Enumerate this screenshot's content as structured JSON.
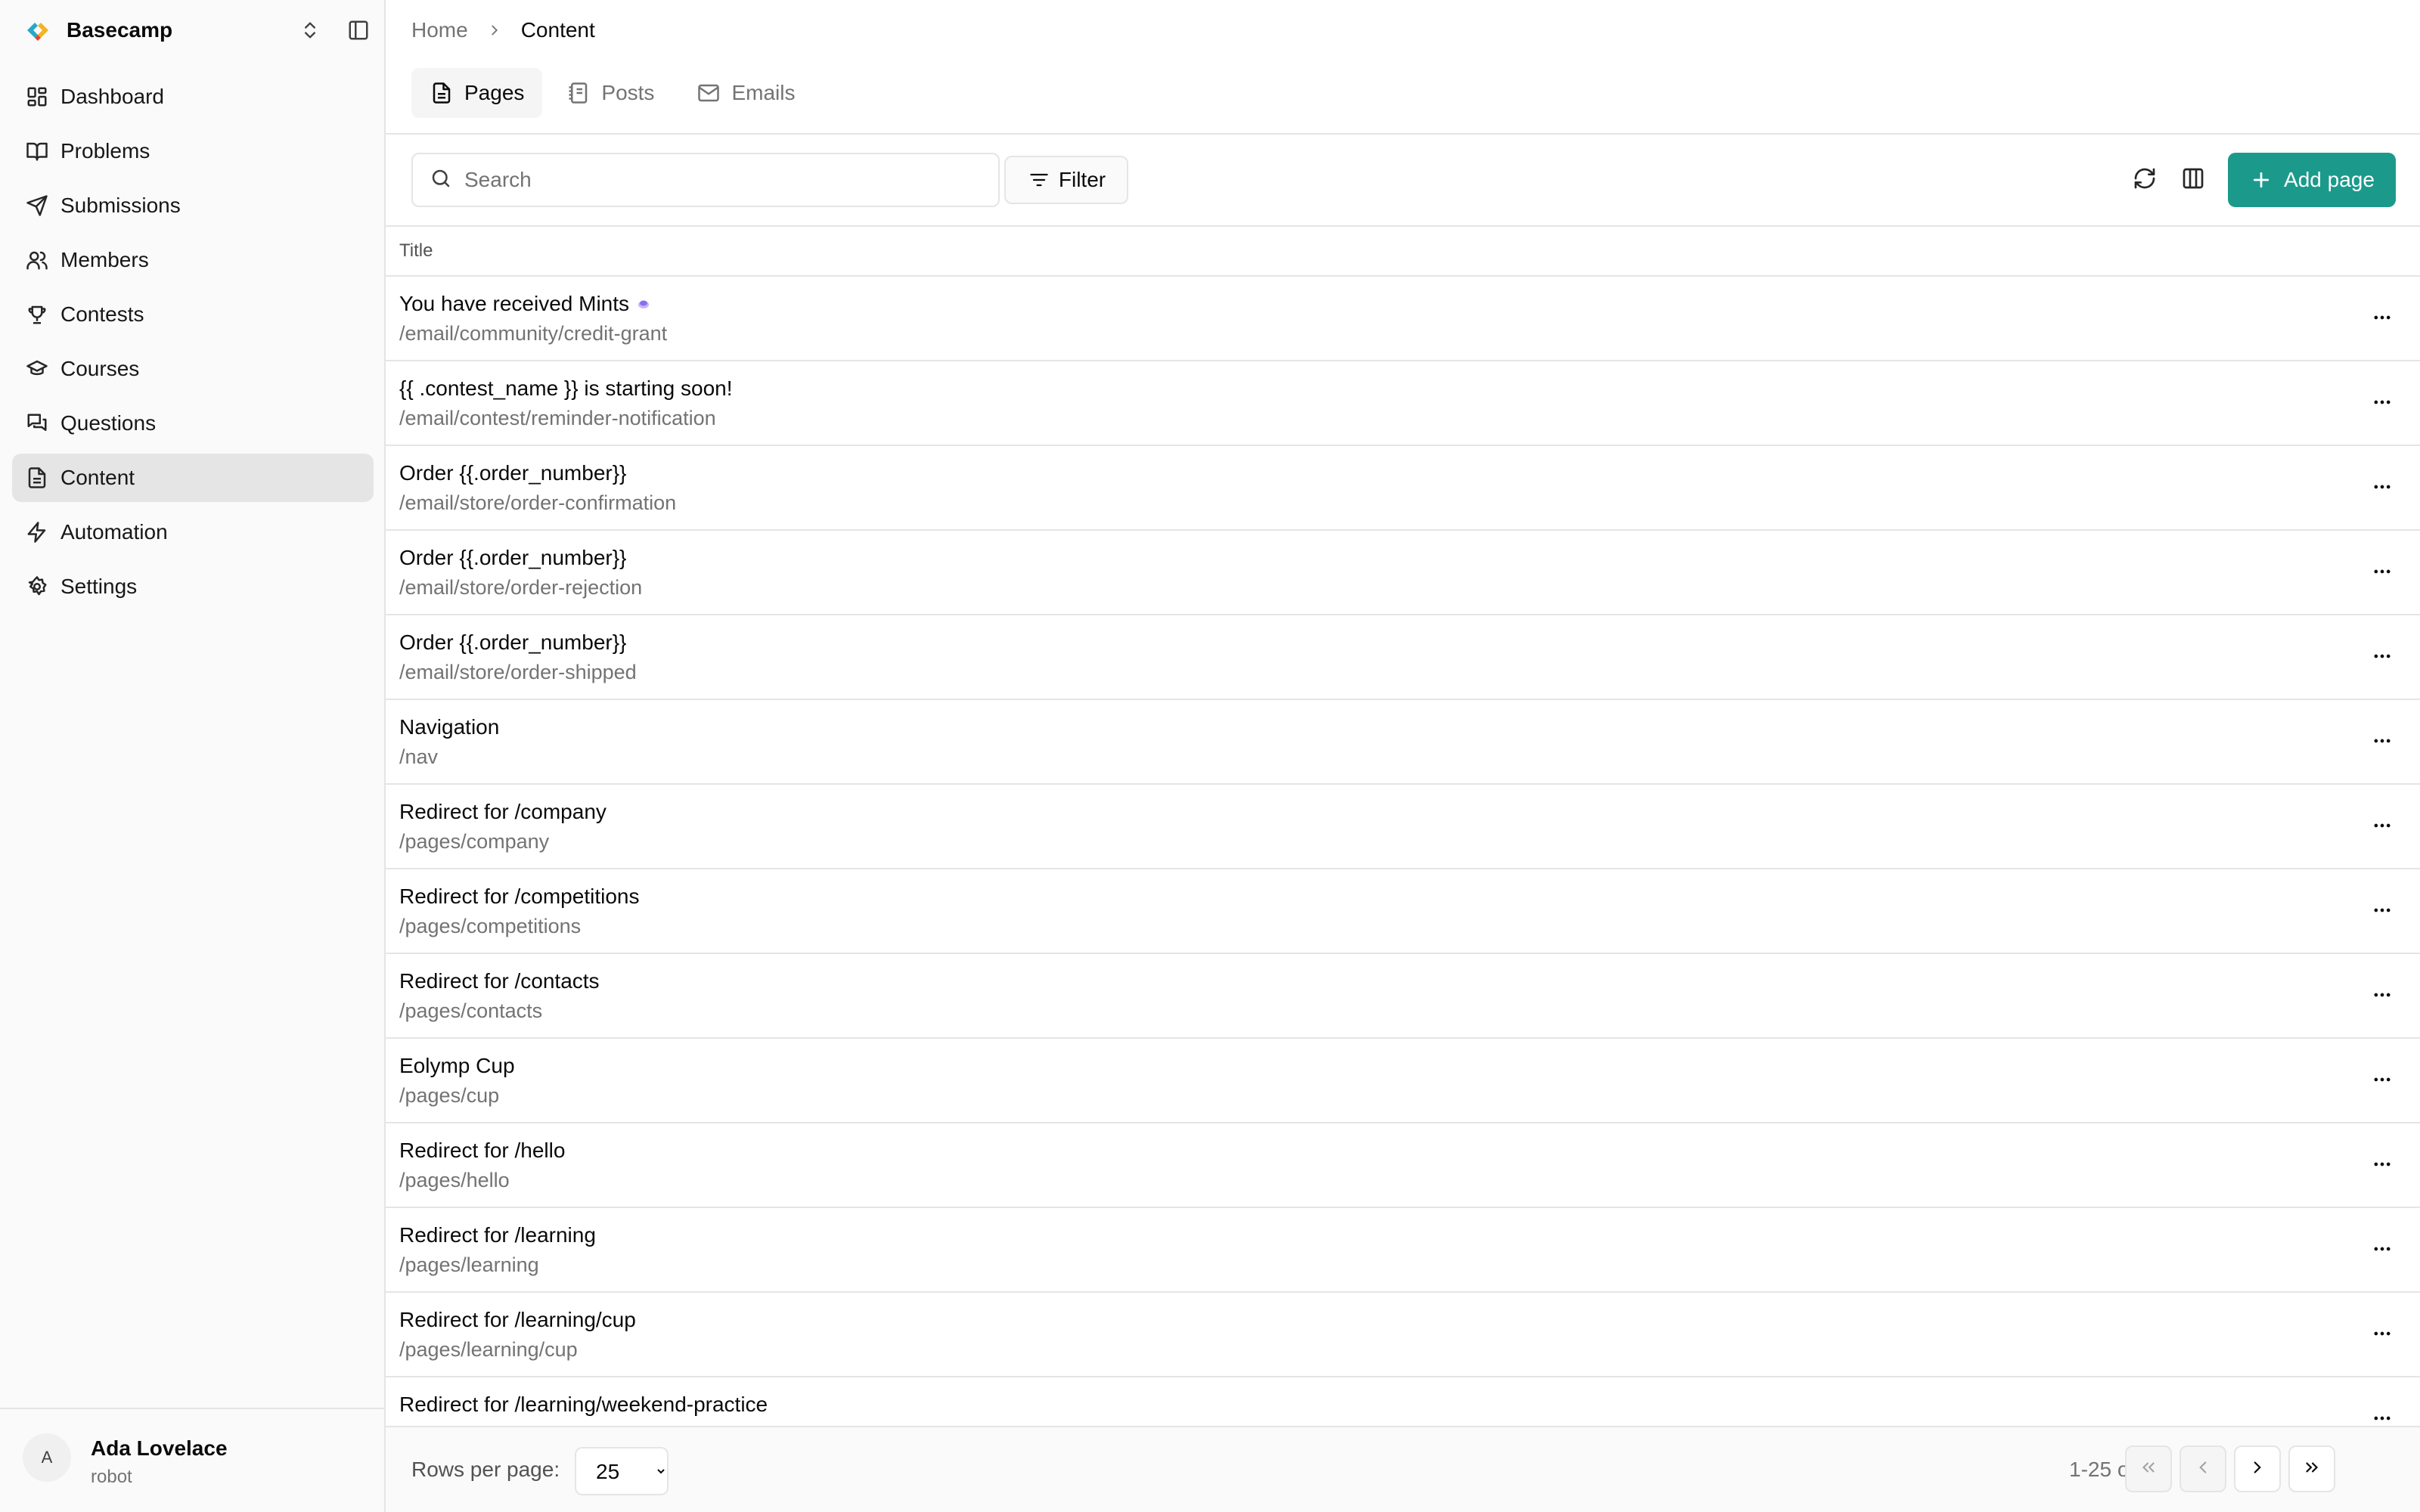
{
  "brand": {
    "name": "Basecamp"
  },
  "sidebar": {
    "items": [
      {
        "label": "Dashboard",
        "icon": "dashboard-icon"
      },
      {
        "label": "Problems",
        "icon": "book-icon"
      },
      {
        "label": "Submissions",
        "icon": "send-icon"
      },
      {
        "label": "Members",
        "icon": "users-icon"
      },
      {
        "label": "Contests",
        "icon": "trophy-icon"
      },
      {
        "label": "Courses",
        "icon": "graduation-cap-icon"
      },
      {
        "label": "Questions",
        "icon": "messages-icon"
      },
      {
        "label": "Content",
        "icon": "file-text-icon",
        "active": true
      },
      {
        "label": "Automation",
        "icon": "zap-icon"
      },
      {
        "label": "Settings",
        "icon": "gear-icon"
      }
    ]
  },
  "user": {
    "initial": "A",
    "name": "Ada Lovelace",
    "role": "robot"
  },
  "breadcrumb": {
    "home": "Home",
    "current": "Content"
  },
  "tabs": [
    {
      "label": "Pages",
      "icon": "file-text-icon",
      "active": true
    },
    {
      "label": "Posts",
      "icon": "notebook-icon"
    },
    {
      "label": "Emails",
      "icon": "mail-icon"
    }
  ],
  "toolbar": {
    "search_placeholder": "Search",
    "filter_label": "Filter",
    "add_label": "Add page"
  },
  "table": {
    "column_title": "Title",
    "rows": [
      {
        "title": "You have received Mints",
        "path": "/email/community/credit-grant"
      },
      {
        "title": "{{ .contest_name }} is starting soon!",
        "path": "/email/contest/reminder-notification"
      },
      {
        "title": "Order {{.order_number}}",
        "path": "/email/store/order-confirmation"
      },
      {
        "title": "Order {{.order_number}}",
        "path": "/email/store/order-rejection"
      },
      {
        "title": "Order {{.order_number}}",
        "path": "/email/store/order-shipped"
      },
      {
        "title": "Navigation",
        "path": "/nav"
      },
      {
        "title": "Redirect for /company",
        "path": "/pages/company"
      },
      {
        "title": "Redirect for /competitions",
        "path": "/pages/competitions"
      },
      {
        "title": "Redirect for /contacts",
        "path": "/pages/contacts"
      },
      {
        "title": "Eolymp Cup",
        "path": "/pages/cup"
      },
      {
        "title": "Redirect for /hello",
        "path": "/pages/hello"
      },
      {
        "title": "Redirect for /learning",
        "path": "/pages/learning"
      },
      {
        "title": "Redirect for /learning/cup",
        "path": "/pages/learning/cup"
      },
      {
        "title": "Redirect for /learning/weekend-practice",
        "path": ""
      }
    ]
  },
  "pagination": {
    "rows_per_page_label": "Rows per page:",
    "rows_per_page": "25",
    "range": "1-25 of 32"
  },
  "colors": {
    "accent": "#1b9a8c",
    "active_nav": "#e5e5e5",
    "muted_text": "#737373"
  }
}
